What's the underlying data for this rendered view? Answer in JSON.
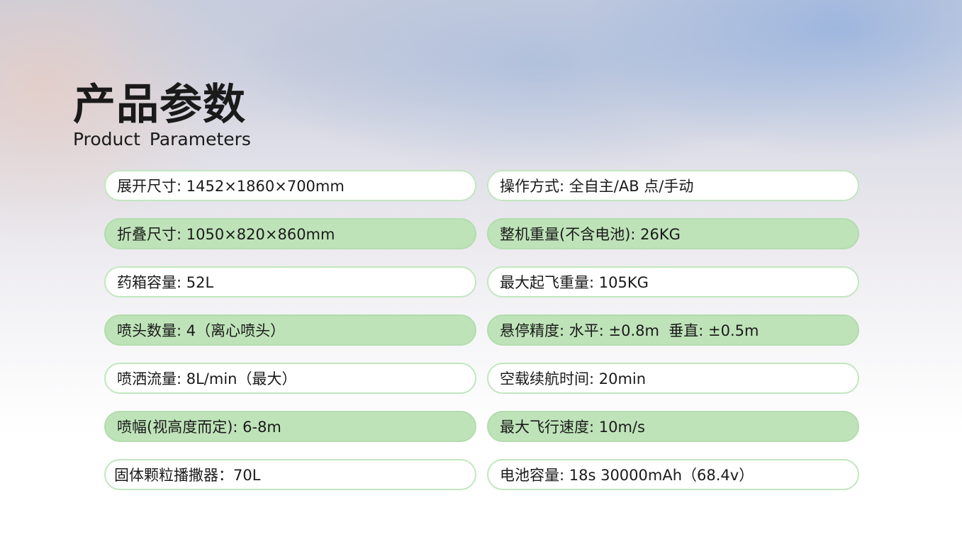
{
  "header": {
    "title_cn": "产品参数",
    "title_en": "Product Parameters"
  },
  "colors": {
    "row_green": "#bfe3b9",
    "row_white_border": "#c2e6c0"
  },
  "params": {
    "left": [
      "展开尺寸: 1452×1860×700mm",
      "折叠尺寸: 1050×820×860mm",
      "药箱容量: 52L",
      "喷头数量: 4（离心喷头）",
      "喷洒流量: 8L/min（最大）",
      "喷幅(视高度而定): 6-8m",
      "固体颗粒播撒器：70L"
    ],
    "right": [
      "操作方式: 全自主/AB 点/手动",
      "整机重量(不含电池): 26KG",
      "最大起飞重量: 105KG",
      "悬停精度: 水平: ±0.8m  垂直: ±0.5m",
      "空载续航时间: 20min",
      "最大飞行速度: 10m/s",
      "电池容量: 18s 30000mAh（68.4v）"
    ]
  }
}
